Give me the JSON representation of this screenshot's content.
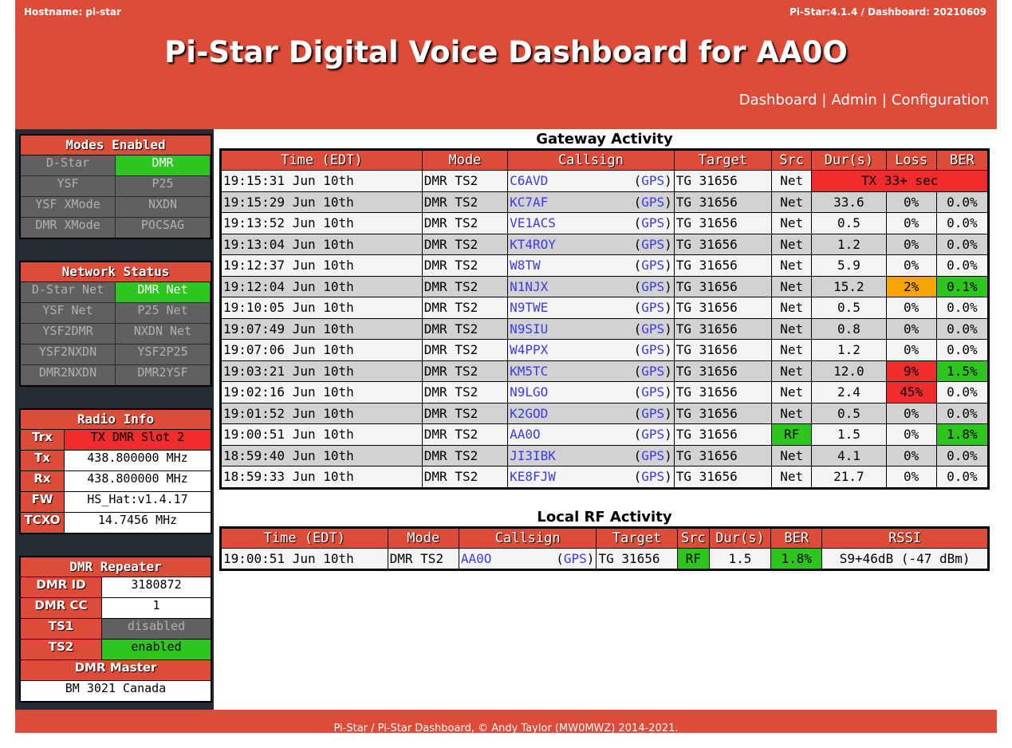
{
  "header": {
    "hostname": "Hostname: pi-star",
    "version": "Pi-Star:4.1.4 / Dashboard: 20210609",
    "title": "Pi-Star Digital Voice Dashboard for AA0O",
    "nav": [
      "Dashboard",
      "Admin",
      "Configuration"
    ]
  },
  "modes": {
    "title": "Modes Enabled",
    "items": [
      {
        "label": "D-Star",
        "on": false
      },
      {
        "label": "DMR",
        "on": true
      },
      {
        "label": "YSF",
        "on": false
      },
      {
        "label": "P25",
        "on": false
      },
      {
        "label": "YSF XMode",
        "on": false
      },
      {
        "label": "NXDN",
        "on": false
      },
      {
        "label": "DMR XMode",
        "on": false
      },
      {
        "label": "POCSAG",
        "on": false
      }
    ]
  },
  "network": {
    "title": "Network Status",
    "items": [
      {
        "label": "D-Star Net",
        "on": false
      },
      {
        "label": "DMR Net",
        "on": true
      },
      {
        "label": "YSF Net",
        "on": false
      },
      {
        "label": "P25 Net",
        "on": false
      },
      {
        "label": "YSF2DMR",
        "on": false
      },
      {
        "label": "NXDN Net",
        "on": false
      },
      {
        "label": "YSF2NXDN",
        "on": false
      },
      {
        "label": "YSF2P25",
        "on": false
      },
      {
        "label": "DMR2NXDN",
        "on": false
      },
      {
        "label": "DMR2YSF",
        "on": false
      }
    ]
  },
  "radio": {
    "title": "Radio Info",
    "trx_label": "Trx",
    "trx": "TX DMR Slot 2",
    "tx_label": "Tx",
    "tx": "438.800000 MHz",
    "rx_label": "Rx",
    "rx": "438.800000 MHz",
    "fw_label": "FW",
    "fw": "HS_Hat:v1.4.17",
    "tcxo_label": "TCXO",
    "tcxo": "14.7456 MHz"
  },
  "repeater": {
    "title": "DMR Repeater",
    "id_label": "DMR ID",
    "id": "3180872",
    "cc_label": "DMR CC",
    "cc": "1",
    "ts1_label": "TS1",
    "ts1": "disabled",
    "ts2_label": "TS2",
    "ts2": "enabled",
    "master_label": "DMR Master",
    "master": "BM 3021 Canada"
  },
  "gateway": {
    "title": "Gateway Activity",
    "headers": [
      "Time (EDT)",
      "Mode",
      "Callsign",
      "Target",
      "Src",
      "Dur(s)",
      "Loss",
      "BER"
    ],
    "gps_label": "GPS",
    "rows": [
      {
        "time": "19:15:31 Jun 10th",
        "mode": "DMR TS2",
        "call": "C6AVD",
        "target": "TG 31656",
        "src": "Net",
        "tx": "TX 33+ sec"
      },
      {
        "time": "19:15:29 Jun 10th",
        "mode": "DMR TS2",
        "call": "KC7AF",
        "target": "TG 31656",
        "src": "Net",
        "dur": "33.6",
        "loss": "0%",
        "ber": "0.0%"
      },
      {
        "time": "19:13:52 Jun 10th",
        "mode": "DMR TS2",
        "call": "VE1ACS",
        "target": "TG 31656",
        "src": "Net",
        "dur": "0.5",
        "loss": "0%",
        "ber": "0.0%"
      },
      {
        "time": "19:13:04 Jun 10th",
        "mode": "DMR TS2",
        "call": "KT4ROY",
        "target": "TG 31656",
        "src": "Net",
        "dur": "1.2",
        "loss": "0%",
        "ber": "0.0%"
      },
      {
        "time": "19:12:37 Jun 10th",
        "mode": "DMR TS2",
        "call": "W8TW",
        "target": "TG 31656",
        "src": "Net",
        "dur": "5.9",
        "loss": "0%",
        "ber": "0.0%"
      },
      {
        "time": "19:12:04 Jun 10th",
        "mode": "DMR TS2",
        "call": "N1NJX",
        "target": "TG 31656",
        "src": "Net",
        "dur": "15.2",
        "loss": "2%",
        "ber": "0.1%",
        "loss_color": "orange",
        "ber_color": "green"
      },
      {
        "time": "19:10:05 Jun 10th",
        "mode": "DMR TS2",
        "call": "N9TWE",
        "target": "TG 31656",
        "src": "Net",
        "dur": "0.5",
        "loss": "0%",
        "ber": "0.0%"
      },
      {
        "time": "19:07:49 Jun 10th",
        "mode": "DMR TS2",
        "call": "N9SIU",
        "target": "TG 31656",
        "src": "Net",
        "dur": "0.8",
        "loss": "0%",
        "ber": "0.0%"
      },
      {
        "time": "19:07:06 Jun 10th",
        "mode": "DMR TS2",
        "call": "W4PPX",
        "target": "TG 31656",
        "src": "Net",
        "dur": "1.2",
        "loss": "0%",
        "ber": "0.0%"
      },
      {
        "time": "19:03:21 Jun 10th",
        "mode": "DMR TS2",
        "call": "KM5TC",
        "target": "TG 31656",
        "src": "Net",
        "dur": "12.0",
        "loss": "9%",
        "ber": "1.5%",
        "loss_color": "red",
        "ber_color": "green"
      },
      {
        "time": "19:02:16 Jun 10th",
        "mode": "DMR TS2",
        "call": "N9LGO",
        "target": "TG 31656",
        "src": "Net",
        "dur": "2.4",
        "loss": "45%",
        "ber": "0.0%",
        "loss_color": "red"
      },
      {
        "time": "19:01:52 Jun 10th",
        "mode": "DMR TS2",
        "call": "K2GOD",
        "target": "TG 31656",
        "src": "Net",
        "dur": "0.5",
        "loss": "0%",
        "ber": "0.0%"
      },
      {
        "time": "19:00:51 Jun 10th",
        "mode": "DMR TS2",
        "call": "AA0O",
        "target": "TG 31656",
        "src": "RF",
        "dur": "1.5",
        "loss": "0%",
        "ber": "1.8%",
        "src_color": "green",
        "ber_color": "green"
      },
      {
        "time": "18:59:40 Jun 10th",
        "mode": "DMR TS2",
        "call": "JI3IBK",
        "target": "TG 31656",
        "src": "Net",
        "dur": "4.1",
        "loss": "0%",
        "ber": "0.0%"
      },
      {
        "time": "18:59:33 Jun 10th",
        "mode": "DMR TS2",
        "call": "KE8FJW",
        "target": "TG 31656",
        "src": "Net",
        "dur": "21.7",
        "loss": "0%",
        "ber": "0.0%"
      }
    ]
  },
  "local": {
    "title": "Local RF Activity",
    "headers": [
      "Time (EDT)",
      "Mode",
      "Callsign",
      "Target",
      "Src",
      "Dur(s)",
      "BER",
      "RSSI"
    ],
    "rows": [
      {
        "time": "19:00:51 Jun 10th",
        "mode": "DMR TS2",
        "call": "AA0O",
        "target": "TG 31656",
        "src": "RF",
        "dur": "1.5",
        "ber": "1.8%",
        "rssi": "S9+46dB (-47 dBm)"
      }
    ]
  },
  "footer": {
    "text": "Pi-Star / Pi-Star Dashboard, © Andy Taylor (MW0MWZ) 2014-2021."
  }
}
